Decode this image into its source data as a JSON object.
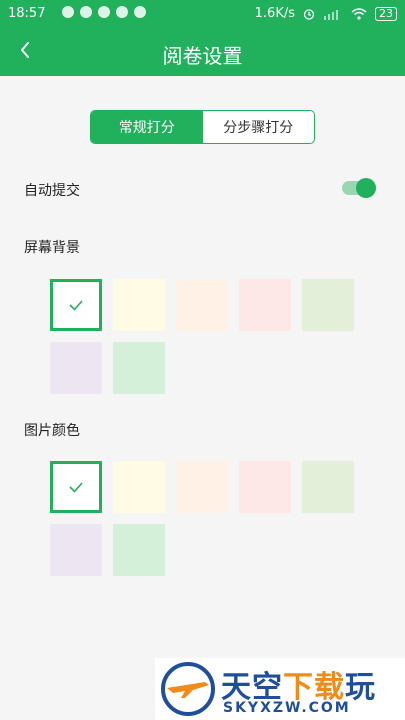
{
  "status_bar": {
    "time": "18:57",
    "network_speed": "1.6K/s",
    "battery": "23"
  },
  "header": {
    "back_icon": "back-chevron-icon",
    "title": "阅卷设置"
  },
  "tabs": [
    {
      "label": "常规打分",
      "active": true
    },
    {
      "label": "分步骤打分",
      "active": false
    }
  ],
  "auto_submit": {
    "label": "自动提交",
    "enabled": true
  },
  "screen_background": {
    "label": "屏幕背景",
    "swatches": [
      "#ffffff",
      "#fffbe5",
      "#fff1e6",
      "#fde8e6",
      "#e3efd9",
      "#eee5f3",
      "#d5f0d9"
    ],
    "selected_index": 0
  },
  "image_color": {
    "label": "图片颜色",
    "swatches": [
      "#ffffff",
      "#fffbe5",
      "#fff1e6",
      "#fde8e6",
      "#e3efd9",
      "#eee5f3",
      "#d5f0d9"
    ],
    "selected_index": 0
  },
  "watermark": {
    "main_blue": "天空",
    "main_orange": "下载",
    "main_blue_2": "玩",
    "sub": "SKYXZW.COM"
  },
  "colors": {
    "accent": "#21b05c"
  }
}
